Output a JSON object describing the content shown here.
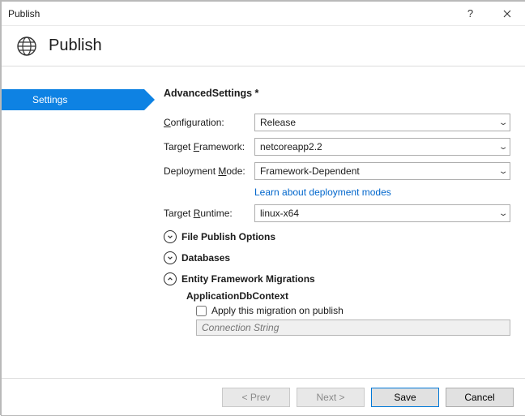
{
  "window": {
    "title": "Publish",
    "help_label": "?",
    "close_label": "✕"
  },
  "header": {
    "title": "Publish"
  },
  "sidebar": {
    "items": [
      {
        "label": "Settings",
        "selected": true
      }
    ]
  },
  "main": {
    "section_title": "AdvancedSettings *",
    "fields": {
      "configuration": {
        "label_pre": "",
        "label_u": "C",
        "label_post": "onfiguration:",
        "value": "Release"
      },
      "target_framework": {
        "label_pre": "Target ",
        "label_u": "F",
        "label_post": "ramework:",
        "value": "netcoreapp2.2"
      },
      "deployment_mode": {
        "label_pre": "Deployment ",
        "label_u": "M",
        "label_post": "ode:",
        "value": "Framework-Dependent",
        "link": "Learn about deployment modes"
      },
      "target_runtime": {
        "label_pre": "Target ",
        "label_u": "R",
        "label_post": "untime:",
        "value": "linux-x64"
      }
    },
    "expanders": {
      "file_publish_options": {
        "label": "File Publish Options",
        "expanded": false
      },
      "databases": {
        "label": "Databases",
        "expanded": false
      },
      "ef_migrations": {
        "label": "Entity Framework Migrations",
        "expanded": true
      }
    },
    "ef": {
      "context_name": "ApplicationDbContext",
      "apply_checkbox_label": "Apply this migration on publish",
      "apply_checked": false,
      "connection_placeholder": "Connection String"
    }
  },
  "footer": {
    "prev": "< Prev",
    "next": "Next >",
    "save": "Save",
    "cancel": "Cancel"
  }
}
